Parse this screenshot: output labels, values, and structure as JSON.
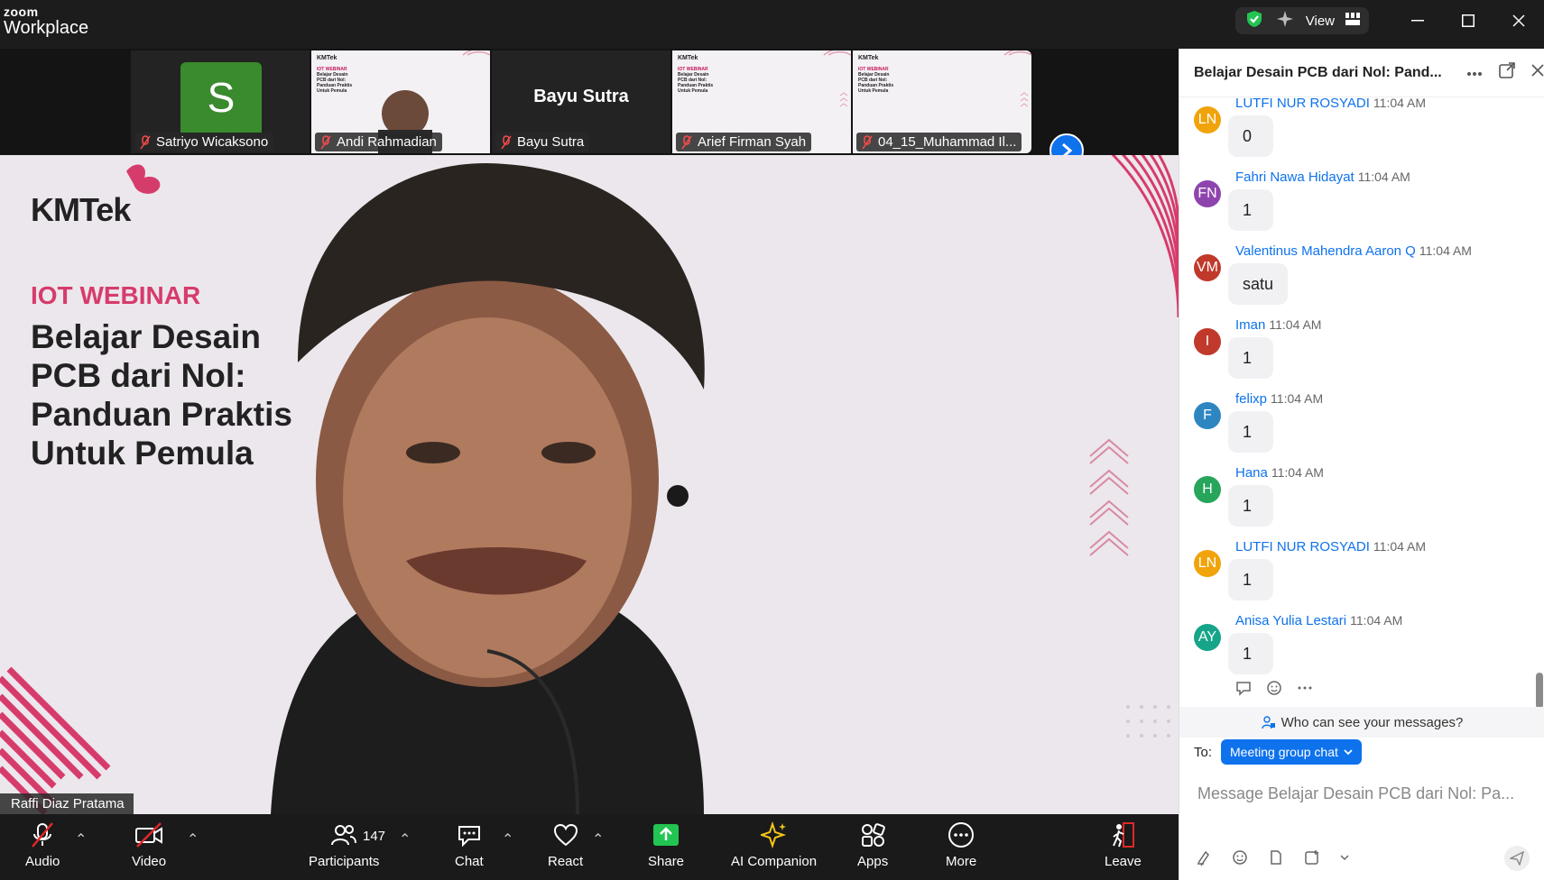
{
  "app": {
    "brand_small": "zoom",
    "brand_big": "Workplace",
    "view_label": "View"
  },
  "strip": {
    "tiles": [
      {
        "name": "Satriyo Wicaksono",
        "avatar_letter": "S"
      },
      {
        "name": "Andi Rahmadian"
      },
      {
        "name": "Bayu Sutra",
        "center_label": "Bayu Sutra"
      },
      {
        "name": "Arief Firman Syah"
      },
      {
        "name": "04_15_Muhammad Il..."
      }
    ]
  },
  "slide": {
    "logo": "KMTek",
    "tag": "IOT WEBINAR",
    "lines": [
      "Belajar Desain",
      "PCB dari Nol:",
      "Panduan Praktis",
      "Untuk Pemula"
    ],
    "mini_lines": [
      "IOT WEBINAR",
      "Belajar Desain",
      "PCB dari Nol:",
      "Panduan Praktis",
      "Untuk Pemula"
    ]
  },
  "speaker": {
    "name": "Raffi Diaz Pratama"
  },
  "controls": {
    "audio": "Audio",
    "video": "Video",
    "participants": "Participants",
    "participant_count": "147",
    "chat": "Chat",
    "react": "React",
    "share": "Share",
    "ai": "AI Companion",
    "apps": "Apps",
    "more": "More",
    "leave": "Leave"
  },
  "chat": {
    "title": "Belajar Desain PCB dari Nol: Pand...",
    "messages": [
      {
        "initials": "LN",
        "color": "#f0a30a",
        "sender": "LUTFI NUR ROSYADI",
        "time": "11:04 AM",
        "text": "0"
      },
      {
        "initials": "FN",
        "color": "#8e44ad",
        "sender": "Fahri Nawa Hidayat",
        "time": "11:04 AM",
        "text": "1"
      },
      {
        "initials": "VM",
        "color": "#c0392b",
        "sender": "Valentinus Mahendra Aaron Q",
        "time": "11:04 AM",
        "text": "satu"
      },
      {
        "initials": "I",
        "color": "#c0392b",
        "sender": "Iman",
        "time": "11:04 AM",
        "text": "1"
      },
      {
        "initials": "F",
        "color": "#2e86c1",
        "sender": "felixp",
        "time": "11:04 AM",
        "text": "1"
      },
      {
        "initials": "H",
        "color": "#27a55b",
        "sender": "Hana",
        "time": "11:04 AM",
        "text": "1"
      },
      {
        "initials": "LN",
        "color": "#f0a30a",
        "sender": "LUTFI NUR ROSYADI",
        "time": "11:04 AM",
        "text": "1"
      },
      {
        "initials": "AY",
        "color": "#17a589",
        "sender": "Anisa Yulia Lestari",
        "time": "11:04 AM",
        "text": "1"
      }
    ],
    "who_can_see": "Who can see your messages?",
    "to_label": "To:",
    "to_value": "Meeting group chat",
    "input_placeholder": "Message Belajar Desain PCB dari Nol: Pa..."
  }
}
